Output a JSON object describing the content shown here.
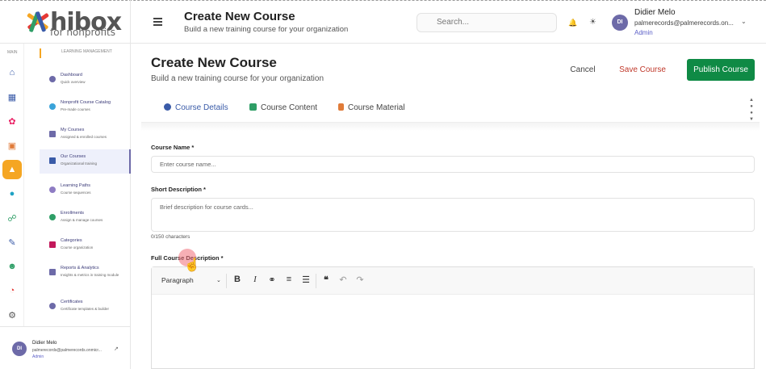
{
  "brand": {
    "name": "hibox",
    "tagline": "for nonprofits"
  },
  "header": {
    "title": "Create New Course",
    "subtitle": "Build a new training course for your organization",
    "search_placeholder": "Search...",
    "user": {
      "initials": "DI",
      "name": "Didier Melo",
      "email": "palmerecords@palmerecords.on...",
      "role": "Admin"
    }
  },
  "sidebar": {
    "rail_label": "MAIN",
    "section_label": "LEARNING MANAGEMENT",
    "items": [
      {
        "title": "Dashboard",
        "sub": "Quick overview",
        "color": "#6d6aa8"
      },
      {
        "title": "Nonprofit Course Catalog",
        "sub": "Pre-made courses",
        "color": "#3aa3d9"
      },
      {
        "title": "My Courses",
        "sub": "Assigned & enrolled courses",
        "color": "#6d6aa8"
      },
      {
        "title": "Our Courses",
        "sub": "Organizational training",
        "color": "#3a5ba8"
      },
      {
        "title": "Learning Paths",
        "sub": "Course sequences",
        "color": "#8e7cc3"
      },
      {
        "title": "Enrollments",
        "sub": "Assign & manage courses",
        "color": "#2e9e66"
      },
      {
        "title": "Categories",
        "sub": "Course organization",
        "color": "#c2185b"
      },
      {
        "title": "Reports & Analytics",
        "sub": "Insights & metrics in training module",
        "color": "#6d6aa8"
      },
      {
        "title": "Certificates",
        "sub": "Certificate templates & builder",
        "color": "#6d6aa8"
      }
    ],
    "rail_icons": [
      "home-icon",
      "org-chart-icon",
      "paint-icon",
      "book-icon",
      "cap-icon",
      "circle-icon",
      "flow-icon",
      "form-icon",
      "people-icon",
      "pie-icon",
      "gear-icon"
    ],
    "footer": {
      "initials": "DI",
      "name": "Didier Melo",
      "email": "palmerecords@palmerecords.onmicr...",
      "role": "Admin"
    }
  },
  "main": {
    "title": "Create New Course",
    "subtitle": "Build a new training course for your organization",
    "cancel_label": "Cancel",
    "save_label": "Save Course",
    "publish_label": "Publish Course",
    "tabs": [
      {
        "label": "Course Details",
        "color": "#3a5ba8"
      },
      {
        "label": "Course Content",
        "color": "#2e9e66"
      },
      {
        "label": "Course Material",
        "color": "#e07b39"
      }
    ],
    "course_name": {
      "label": "Course Name *",
      "placeholder": "Enter course name..."
    },
    "short_desc": {
      "label": "Short Description *",
      "placeholder": "Brief description for course cards...",
      "counter": "0/150 characters"
    },
    "full_desc": {
      "label": "Full Course Description *",
      "format": "Paragraph"
    }
  }
}
